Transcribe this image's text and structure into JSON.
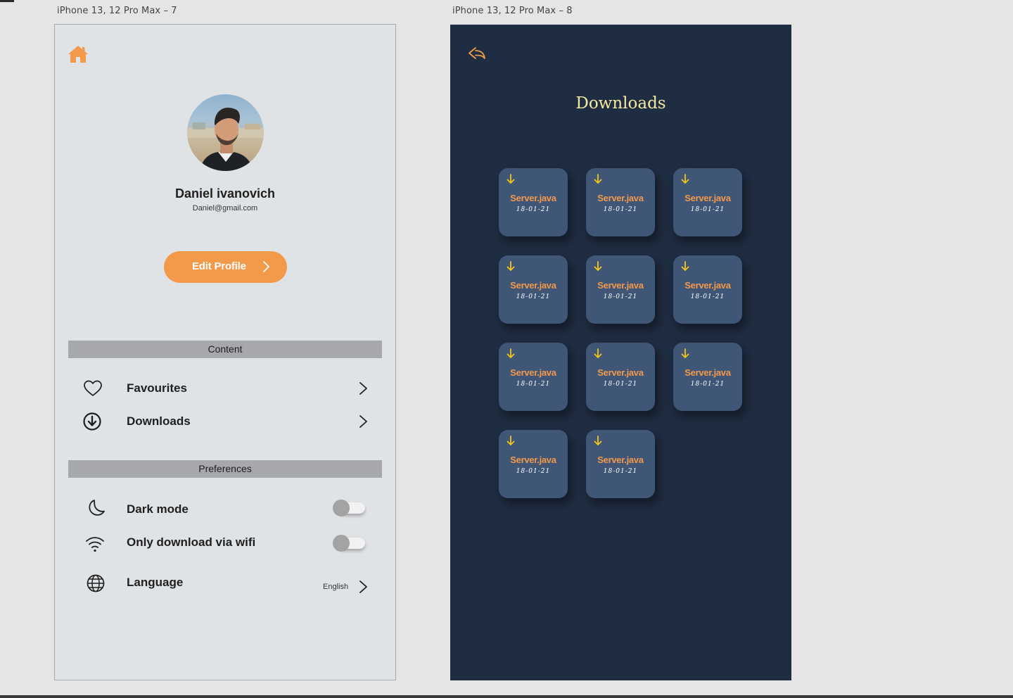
{
  "artboards": {
    "left_label": "iPhone 13, 12 Pro Max – 7",
    "right_label": "iPhone 13, 12 Pro Max – 8"
  },
  "profile": {
    "name": "Daniel ivanovich",
    "email": "Daniel@gmail.com",
    "edit_button": "Edit Profile"
  },
  "content_section": {
    "header": "Content",
    "items": [
      {
        "label": "Favourites",
        "icon": "heart-icon"
      },
      {
        "label": "Downloads",
        "icon": "download-circle-icon"
      }
    ]
  },
  "preferences_section": {
    "header": "Preferences",
    "items": [
      {
        "label": "Dark mode",
        "icon": "moon-icon",
        "toggle_on": false
      },
      {
        "label": "Only download via wifi",
        "icon": "wifi-icon",
        "toggle_on": false
      },
      {
        "label": "Language",
        "icon": "globe-icon",
        "value": "English"
      }
    ]
  },
  "downloads": {
    "title": "Downloads",
    "files": [
      {
        "name": "Server.java",
        "date": "18-01-21"
      },
      {
        "name": "Server.java",
        "date": "18-01-21"
      },
      {
        "name": "Server.java",
        "date": "18-01-21"
      },
      {
        "name": "Server.java",
        "date": "18-01-21"
      },
      {
        "name": "Server.java",
        "date": "18-01-21"
      },
      {
        "name": "Server.java",
        "date": "18-01-21"
      },
      {
        "name": "Server.java",
        "date": "18-01-21"
      },
      {
        "name": "Server.java",
        "date": "18-01-21"
      },
      {
        "name": "Server.java",
        "date": "18-01-21"
      },
      {
        "name": "Server.java",
        "date": "18-01-21"
      },
      {
        "name": "Server.java",
        "date": "18-01-21"
      }
    ]
  },
  "colors": {
    "accent": "#f3994a",
    "light_bg": "#e0e3e6",
    "dark_bg": "#1f2d42",
    "tile_bg": "#3f5677",
    "title_yellow": "#f4e9a1",
    "arrow_yellow": "#f5c518"
  }
}
